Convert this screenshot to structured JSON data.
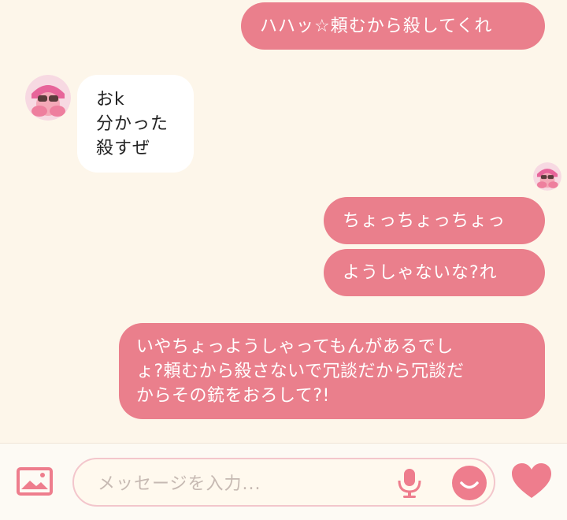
{
  "messages": [
    {
      "side": "out",
      "text": "ハハッ☆頼むから殺してくれ"
    },
    {
      "side": "in",
      "lines": [
        "おk",
        "分かった",
        "殺すぜ"
      ]
    },
    {
      "side": "out",
      "text": "ちょっちょっちょっ"
    },
    {
      "side": "out",
      "text": "ようしゃないな?れ"
    },
    {
      "side": "out",
      "lines": [
        "いやちょっようしゃってもんがあるでし",
        "ょ?頼むから殺さないで冗談だから冗談だ",
        "からその銃をおろして?!"
      ]
    }
  ],
  "input": {
    "placeholder": "メッセージを入力..."
  },
  "icons": {
    "image": "image-icon",
    "mic": "microphone-icon",
    "sticker": "smiley-icon",
    "like": "heart-icon"
  },
  "colors": {
    "background": "#fdf6ea",
    "outgoing_bubble": "#ea7f8c",
    "incoming_bubble": "#ffffff",
    "accent": "#ee7d8d"
  }
}
